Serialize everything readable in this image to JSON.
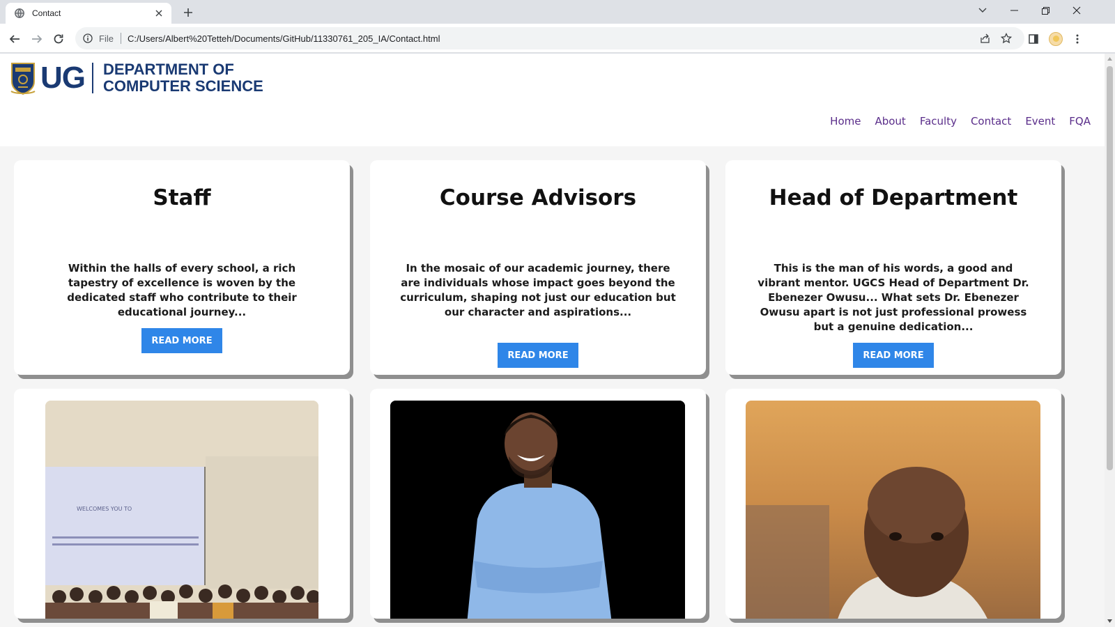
{
  "browser": {
    "tab_title": "Contact",
    "omnibox_scheme": "File",
    "url": "C:/Users/Albert%20Tetteh/Documents/GitHub/11330761_205_IA/Contact.html"
  },
  "site": {
    "logo_short": "UG",
    "logo_line1": "DEPARTMENT OF",
    "logo_line2": "COMPUTER SCIENCE",
    "nav": [
      "Home",
      "About",
      "Faculty",
      "Contact",
      "Event",
      "FQA"
    ]
  },
  "cards": [
    {
      "title": "Staff",
      "text": "Within the halls of every school, a rich tapestry of excellence is woven by the dedicated staff who contribute to their educational journey...",
      "button": "READ MORE"
    },
    {
      "title": "Course Advisors",
      "text": "In the mosaic of our academic journey, there are individuals whose impact goes beyond the curriculum, shaping not just our education but our character and aspirations...",
      "button": "READ MORE"
    },
    {
      "title": "Head of Department",
      "text": "This is the man of his words, a good and vibrant mentor. UGCS Head of Department Dr. Ebenezer Owusu... What sets Dr. Ebenezer Owusu apart is not just professional prowess but a genuine dedication...",
      "button": "READ MORE"
    }
  ],
  "photos": {
    "staff_slide_text": "WELCOMES YOU TO"
  },
  "colors": {
    "brand_blue": "#1a3a73",
    "nav_link": "#5a2d8a",
    "button": "#2f86e8"
  }
}
